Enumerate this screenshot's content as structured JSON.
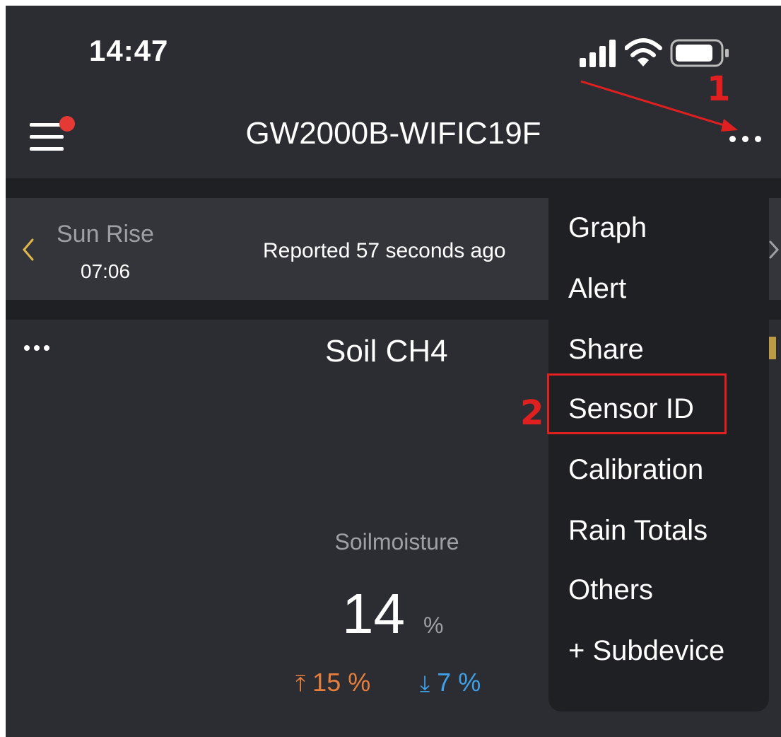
{
  "status_bar": {
    "time": "14:47",
    "icons": [
      "signal-icon",
      "wifi-icon",
      "battery-icon"
    ]
  },
  "header": {
    "title": "GW2000B-WIFIC19F",
    "menu_icon": "hamburger-icon",
    "more_icon": "more-horizontal-icon",
    "notification_dot_color": "#e53935"
  },
  "sun_bar": {
    "label": "Sun Rise",
    "time": "07:06",
    "reported": "Reported 57 seconds ago"
  },
  "card": {
    "title": "Soil CH4",
    "metric_label": "Soilmoisture",
    "value": "14",
    "unit": "%",
    "high": "15 %",
    "low": "7 %",
    "high_icon": "↑",
    "low_icon": "↓",
    "high_color": "#e67e3e",
    "low_color": "#3fa0e8"
  },
  "dropdown": {
    "items": [
      "Graph",
      "Alert",
      "Share",
      "Sensor ID",
      "Calibration",
      "Rain Totals",
      "Others",
      "+ Subdevice"
    ],
    "highlighted": "Sensor ID"
  },
  "annotations": {
    "step1": "1",
    "step2": "2",
    "color": "#e02020"
  }
}
